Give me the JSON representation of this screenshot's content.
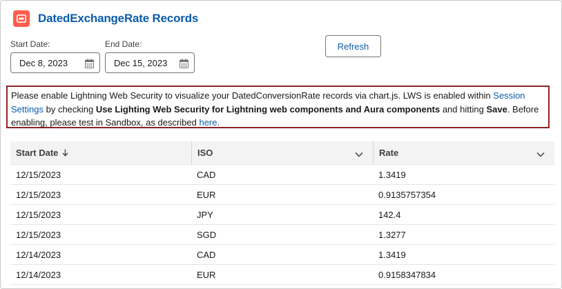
{
  "header": {
    "title": "DatedExchangeRate Records",
    "icon": "chart-icon",
    "icon_color": "#fe5c4c"
  },
  "filters": {
    "start_label": "Start Date:",
    "start_value": "Dec 8, 2023",
    "end_label": "End Date:",
    "end_value": "Dec 15, 2023",
    "refresh_label": "Refresh"
  },
  "notice": {
    "text1": "Please enable Lightning Web Security to visualize your DatedConversionRate records via chart.js. LWS is enabled within ",
    "link1": "Session Settings",
    "text2": " by checking ",
    "bold1": "Use Lighting Web Security for Lightning web components and Aura components",
    "text3": " and hitting ",
    "bold2": "Save",
    "text4": ". Before enabling, please test in Sandbox, as described ",
    "link2": "here",
    "text5": ".",
    "border_color": "#8e2222"
  },
  "table": {
    "columns": [
      "Start Date",
      "ISO",
      "Rate"
    ],
    "rows": [
      [
        "12/15/2023",
        "CAD",
        "1.3419"
      ],
      [
        "12/15/2023",
        "EUR",
        "0.9135757354"
      ],
      [
        "12/15/2023",
        "JPY",
        "142.4"
      ],
      [
        "12/15/2023",
        "SGD",
        "1.3277"
      ],
      [
        "12/14/2023",
        "CAD",
        "1.3419"
      ],
      [
        "12/14/2023",
        "EUR",
        "0.9158347834"
      ]
    ]
  }
}
